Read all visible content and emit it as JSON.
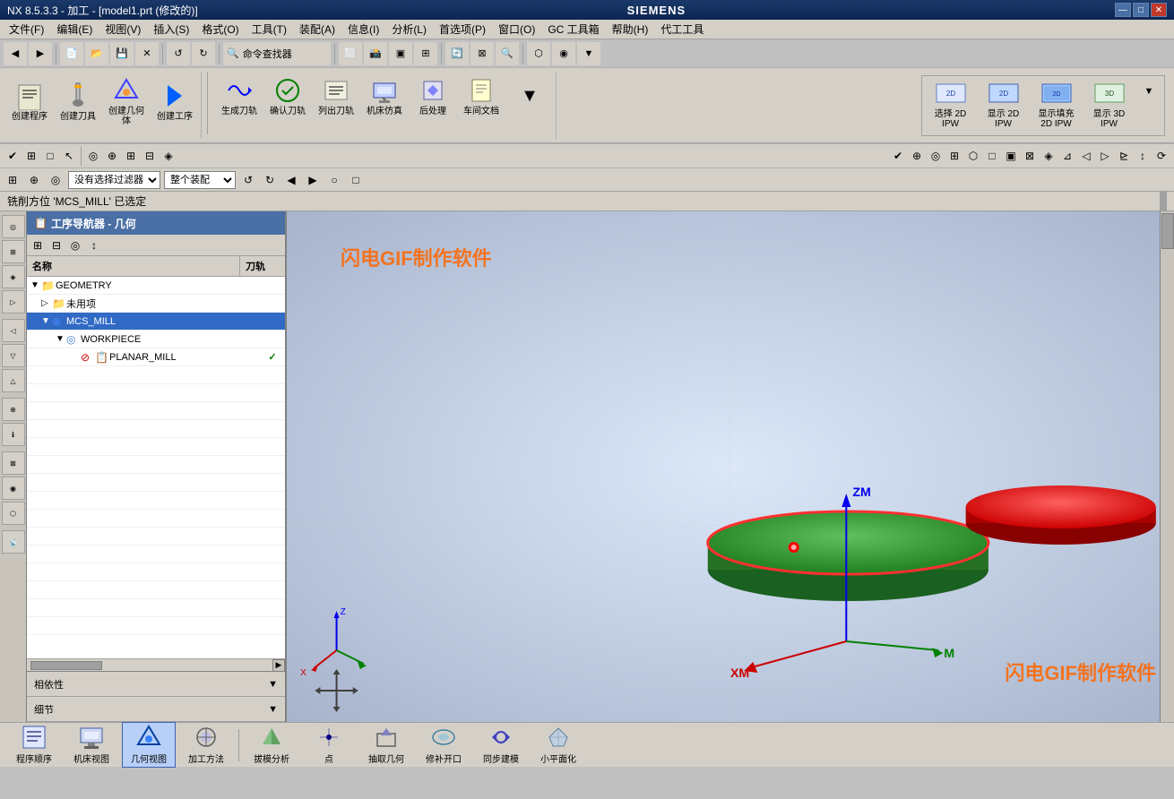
{
  "titlebar": {
    "title": "NX 8.5.3.3 - 加工 - [model1.prt (修改的)]",
    "siemens": "SIEMENS",
    "win_btns": [
      "—",
      "□",
      "✕"
    ]
  },
  "menubar": {
    "items": [
      "文件(F)",
      "编辑(E)",
      "视图(V)",
      "插入(S)",
      "格式(O)",
      "工具(T)",
      "装配(A)",
      "信息(I)",
      "分析(L)",
      "首选项(P)",
      "窗口(O)",
      "GC 工具箱",
      "帮助(H)",
      "代工工具"
    ]
  },
  "toolbar": {
    "row1_items": [
      "◀",
      "▶",
      "✕",
      "↺",
      "↻",
      "🔍"
    ],
    "command_finder": "命令查找器"
  },
  "ribbon": {
    "groups": [
      {
        "buttons": [
          {
            "label": "创建程序",
            "icon": "📋"
          },
          {
            "label": "创建刀具",
            "icon": "🔧"
          },
          {
            "label": "创建几何体",
            "icon": "📐"
          },
          {
            "label": "创建工序",
            "icon": "▶"
          }
        ]
      },
      {
        "buttons": [
          {
            "label": "生成刀轨",
            "icon": "⚙"
          },
          {
            "label": "确认刀轨",
            "icon": "✓"
          },
          {
            "label": "列出刀轨",
            "icon": "📋"
          },
          {
            "label": "机床仿真",
            "icon": "🖥"
          },
          {
            "label": "后处理",
            "icon": "📤"
          },
          {
            "label": "车间文档",
            "icon": "📄"
          }
        ]
      }
    ]
  },
  "ipw_toolbar": {
    "buttons": [
      {
        "label": "选择 2D\nIPW",
        "icon": "□"
      },
      {
        "label": "显示 2D\nIPW",
        "icon": "□"
      },
      {
        "label": "显示填充\n2D IPW",
        "icon": "□"
      },
      {
        "label": "显示 3D\nIPW",
        "icon": "□"
      }
    ]
  },
  "selection_bar": {
    "filter_label": "没有选择过滤器",
    "assembly_label": "整个装配",
    "options": [
      "没有选择过滤器",
      "整个装配"
    ]
  },
  "status_message": "铣削方位 'MCS_MILL' 已选定",
  "panel": {
    "title": "工序导航器 - 几何",
    "columns": {
      "name": "名称",
      "tool": "刀轨"
    },
    "tree": [
      {
        "level": 0,
        "name": "GEOMETRY",
        "type": "header",
        "expanded": true
      },
      {
        "level": 1,
        "name": "未用项",
        "type": "folder",
        "icon": "📁"
      },
      {
        "level": 1,
        "name": "MCS_MILL",
        "type": "mcs",
        "icon": "⊕",
        "selected": true
      },
      {
        "level": 2,
        "name": "WORKPIECE",
        "type": "workpiece",
        "icon": "◎"
      },
      {
        "level": 3,
        "name": "PLANAR_MILL",
        "type": "mill",
        "icon": "⊘",
        "check": "✓"
      }
    ],
    "sections": [
      {
        "label": "相依性"
      },
      {
        "label": "细节"
      }
    ]
  },
  "viewport": {
    "watermark": "闪电GIF制作软件",
    "watermark2": "闪电GIF制作软件",
    "axis": {
      "zm_label": "ZM",
      "xm_label": "XM",
      "m_label": "M"
    }
  },
  "bottom_toolbar": {
    "buttons": [
      {
        "label": "程序顺序",
        "icon": "📋"
      },
      {
        "label": "机床视图",
        "icon": "🖥"
      },
      {
        "label": "几何视图",
        "icon": "📐"
      },
      {
        "label": "加工方法",
        "icon": "⚙"
      },
      {
        "label": "拔模分析",
        "icon": "📊"
      },
      {
        "label": "点",
        "icon": "•"
      },
      {
        "label": "抽取几何",
        "icon": "📐"
      },
      {
        "label": "修补开口",
        "icon": "🔧"
      },
      {
        "label": "同步建模",
        "icon": "🔄"
      },
      {
        "label": "小平面化",
        "icon": "⬡"
      }
    ]
  }
}
